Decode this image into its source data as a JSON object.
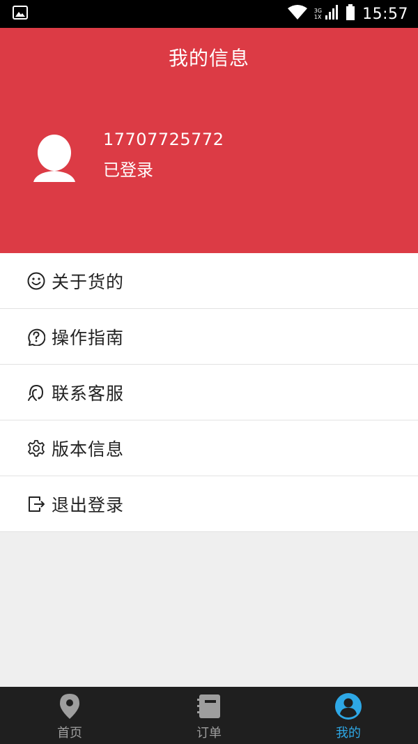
{
  "status_bar": {
    "time": "15:57",
    "network_top": "3G",
    "network_bottom": "1X",
    "icons": [
      "image-icon",
      "wifi-icon",
      "signal-icon",
      "battery-icon"
    ]
  },
  "header": {
    "title": "我的信息",
    "phone": "17707725772",
    "login_status": "已登录",
    "background_color": "#dc3b45"
  },
  "menu": {
    "items": [
      {
        "label": "关于货的",
        "icon": "smiley-icon"
      },
      {
        "label": "操作指南",
        "icon": "help-circle-icon"
      },
      {
        "label": "联系客服",
        "icon": "headset-icon"
      },
      {
        "label": "版本信息",
        "icon": "gear-icon"
      },
      {
        "label": "退出登录",
        "icon": "logout-icon"
      }
    ]
  },
  "bottom_nav": {
    "active_color": "#2ea8e6",
    "items": [
      {
        "label": "首页",
        "icon": "location-pin-icon",
        "active": false
      },
      {
        "label": "订单",
        "icon": "notebook-icon",
        "active": false
      },
      {
        "label": "我的",
        "icon": "user-circle-icon",
        "active": true
      }
    ]
  }
}
